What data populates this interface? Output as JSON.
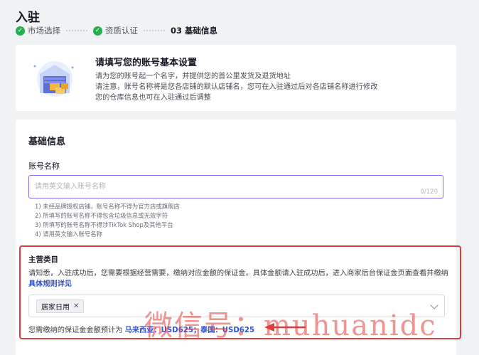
{
  "page": {
    "title": "入驻"
  },
  "steps": [
    {
      "label": "市场选择",
      "state": "done"
    },
    {
      "label": "资质认证",
      "state": "done"
    },
    {
      "number": "03",
      "label": "基础信息",
      "state": "active"
    }
  ],
  "intro": {
    "title": "请填写您的账号基本设置",
    "lines": [
      "请为您的账号起一个名字，并提供您的首公里发货及退货地址",
      "请注意，账号名称将是您各店铺的默认店铺名，您可在入驻通过后对各店铺名称进行修改",
      "您的仓库信息也可在入驻通过后调整"
    ]
  },
  "form": {
    "section_title": "基础信息",
    "account_name": {
      "label": "账号名称",
      "placeholder": "请用英文输入账号名称",
      "value": "",
      "counter": "0/120",
      "rules": [
        "1) 未经品牌授权店铺，账号名称不得为官方店或旗舰店",
        "2) 所填写的账号名称不得包含垃圾信息或无效字符",
        "3) 所填写的账号名称不得涉TikTok Shop及其他平台",
        "4) 请用英文输入账号名称"
      ]
    },
    "category": {
      "label": "主营类目",
      "description": "请知悉，入驻成功后，您需要根据经营需要，缴纳对应金额的保证金。具体金额请入驻成功后，进入商家后台保证金页面查看并缴纳",
      "link_text": "具体规则详见",
      "selected_tag": "居家日用",
      "deposit_prefix": "您需缴纳的保证金金额预计为",
      "deposit_value": "马来西亚：USD625；泰国：USD625"
    }
  },
  "watermark": "微信号：muhuanidc",
  "colors": {
    "accent": "#7b6cf0",
    "link": "#2f52d6",
    "success": "#22b14c",
    "highlight": "#e23b3b"
  }
}
